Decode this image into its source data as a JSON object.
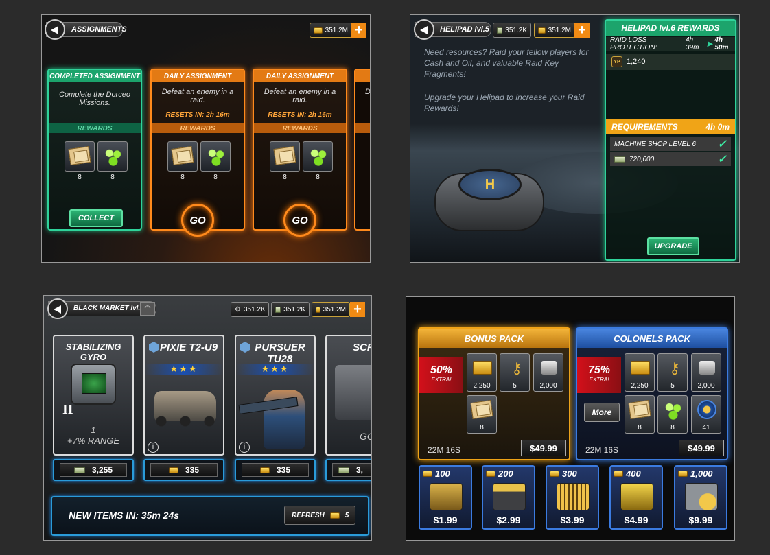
{
  "assignments": {
    "title": "ASSIGNMENTS",
    "gold": "351.2M",
    "cards": [
      {
        "header": "COMPLETED ASSIGNMENT",
        "desc": "Complete the Dorceo Missions.",
        "resets": "",
        "rewards_label": "REWARDS",
        "reward1": "8",
        "reward2": "8",
        "action": "COLLECT"
      },
      {
        "header": "DAILY ASSIGNMENT",
        "desc": "Defeat an enemy in a raid.",
        "resets": "RESETS IN: 2h 16m",
        "rewards_label": "REWARDS",
        "reward1": "8",
        "reward2": "8",
        "action": "GO"
      },
      {
        "header": "DAILY ASSIGNMENT",
        "desc": "Defeat an enemy in a raid.",
        "resets": "RESETS IN: 2h 16m",
        "rewards_label": "REWARDS",
        "reward1": "8",
        "reward2": "8",
        "action": "GO"
      }
    ],
    "partial_card_text": "De"
  },
  "helipad": {
    "title": "HELIPAD lvl.5",
    "cash": "351.2K",
    "gold": "351.2M",
    "info1": "Need resources? Raid your fellow players for Cash and Oil, and valuable Raid Key Fragments!",
    "info2": "Upgrade your Helipad to increase your Raid Rewards!",
    "rewards_title": "HELIPAD lvl.6 REWARDS",
    "protection_label": "RAID LOSS PROTECTION:",
    "protection_from": "4h 39m",
    "protection_to": "4h 50m",
    "yp_icon": "YP",
    "yp_value": "1,240",
    "requirements_label": "REQUIREMENTS",
    "requirements_time": "4h 0m",
    "req1": "MACHINE SHOP LEVEL 6",
    "req2": "720,000",
    "check": "✓",
    "pad_letter": "H",
    "upgrade": "UPGRADE"
  },
  "market": {
    "title": "BLACK MARKET   lvl. 7",
    "res1": "351.2K",
    "res2": "351.2K",
    "res3": "351.2M",
    "cards": [
      {
        "name": "STABILIZING GYRO",
        "tier": "II",
        "line1": "1",
        "line2": "+7% RANGE",
        "price": "3,255"
      },
      {
        "name": "PIXIE T2-U9",
        "stars": "★★★",
        "price": "335"
      },
      {
        "name": "PURSUER TU28",
        "stars": "★★★",
        "price": "335"
      }
    ],
    "partial_name": "SCR",
    "partial_text": "GO",
    "partial_price": "3,",
    "info_icon": "i",
    "new_items": "NEW ITEMS IN: 35m 24s",
    "refresh_label": "REFRESH",
    "refresh_cost": "5"
  },
  "store": {
    "packs": [
      {
        "name": "BONUS PACK",
        "pct": "50%",
        "extra": "EXTRA!",
        "items": [
          "2,250",
          "5",
          "2,000",
          "8"
        ],
        "time": "22M 16S",
        "price": "$49.99"
      },
      {
        "name": "COLONELS PACK",
        "pct": "75%",
        "extra": "EXTRA!",
        "items": [
          "2,250",
          "5",
          "2,000",
          "8",
          "8",
          "41"
        ],
        "time": "22M 16S",
        "price": "$49.99",
        "more": "More"
      }
    ],
    "gold_offers": [
      {
        "amount": "100",
        "price": "$1.99"
      },
      {
        "amount": "200",
        "price": "$2.99"
      },
      {
        "amount": "300",
        "price": "$3.99"
      },
      {
        "amount": "400",
        "price": "$4.99"
      },
      {
        "amount": "1,000",
        "price": "$9.99"
      }
    ]
  }
}
